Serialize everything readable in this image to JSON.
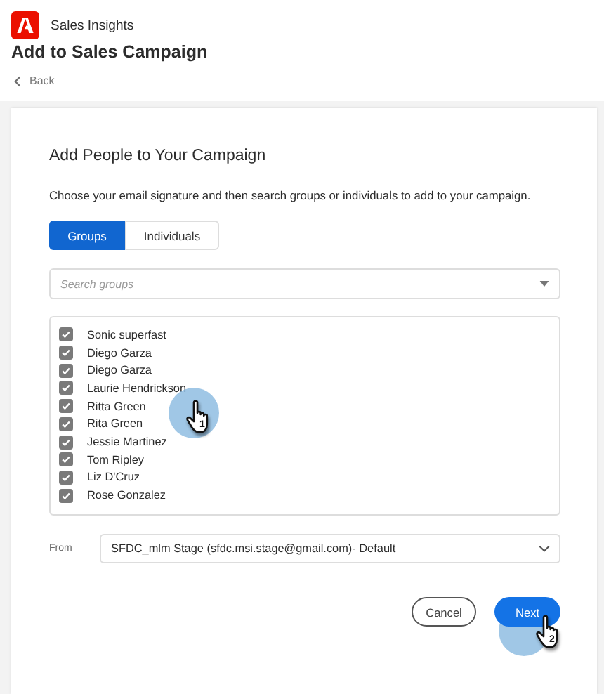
{
  "app": {
    "name": "Sales Insights"
  },
  "page": {
    "title": "Add to Sales Campaign",
    "back": "Back"
  },
  "card": {
    "title": "Add People to Your Campaign",
    "description": "Choose your email signature and then search groups or individuals to add to your campaign.",
    "tabs": [
      {
        "label": "Groups",
        "selected": true
      },
      {
        "label": "Individuals",
        "selected": false
      }
    ],
    "search": {
      "placeholder": "Search groups"
    },
    "items": [
      {
        "label": "Sonic superfast",
        "checked": true
      },
      {
        "label": "Diego Garza",
        "checked": true
      },
      {
        "label": "Diego Garza",
        "checked": true
      },
      {
        "label": "Laurie Hendrickson",
        "checked": true
      },
      {
        "label": "Ritta Green",
        "checked": true
      },
      {
        "label": "Rita Green",
        "checked": true
      },
      {
        "label": "Jessie Martinez",
        "checked": true
      },
      {
        "label": "Tom Ripley",
        "checked": true
      },
      {
        "label": "Liz D'Cruz",
        "checked": true
      },
      {
        "label": "Rose Gonzalez",
        "checked": true
      }
    ],
    "from": {
      "label": "From",
      "value": "SFDC_mlm Stage (sfdc.msi.stage@gmail.com)- Default"
    },
    "buttons": [
      {
        "label": "Cancel",
        "kind": "secondary"
      },
      {
        "label": "Next",
        "kind": "primary"
      }
    ]
  },
  "annotations": [
    {
      "step": "1"
    },
    {
      "step": "2"
    }
  ]
}
